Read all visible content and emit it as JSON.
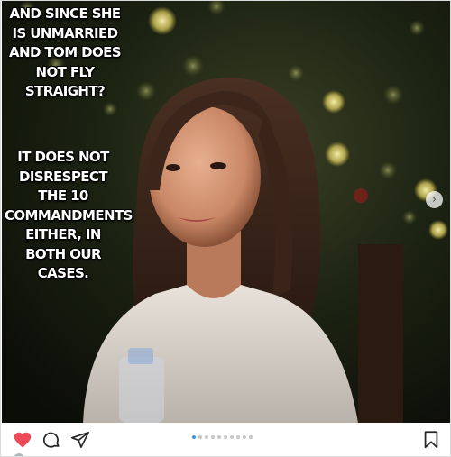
{
  "post": {
    "caption_top": "AND SINCE SHE IS UNMARRIED AND TOM DOES NOT FLY STRAIGHT?",
    "caption_bottom": "IT DOES NOT DISRESPECT THE 10 COMMANDMENTS EITHER, IN BOTH OUR CASES.",
    "carousel": {
      "total_slides": 10,
      "current_slide": 1
    },
    "liked": true
  },
  "icons": {
    "like": "heart-icon",
    "comment": "comment-icon",
    "share": "paper-plane-icon",
    "save": "bookmark-icon",
    "next": "chevron-right-icon"
  },
  "colors": {
    "like_red": "#ed4956",
    "carousel_active": "#3897f0",
    "carousel_inactive": "#c7c7c7"
  }
}
